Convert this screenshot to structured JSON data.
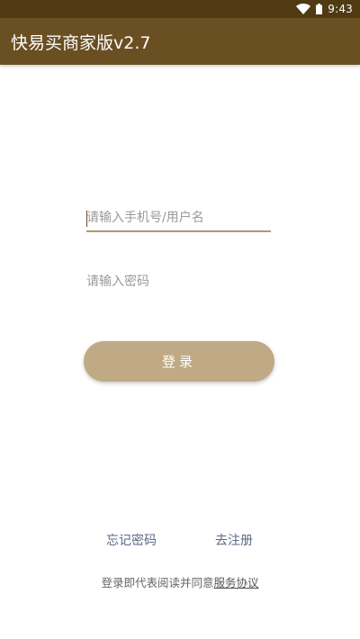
{
  "status_bar": {
    "time": "9:43",
    "wifi_icon": "wifi-icon",
    "battery_icon": "battery-icon",
    "bar_color": "#4f3a14"
  },
  "app_bar": {
    "title": "快易买商家版v2.7",
    "bar_color": "#6a4f22"
  },
  "login_form": {
    "username_placeholder": "请输入手机号/用户名",
    "username_value": "",
    "password_placeholder": "请输入密码",
    "password_value": "",
    "login_label": "登录",
    "button_color": "#c0aa85"
  },
  "links": {
    "forgot_password": "忘记密码",
    "register": "去注册"
  },
  "agreement": {
    "prefix": "登录即代表阅读并同意",
    "service_link": "服务协议"
  }
}
